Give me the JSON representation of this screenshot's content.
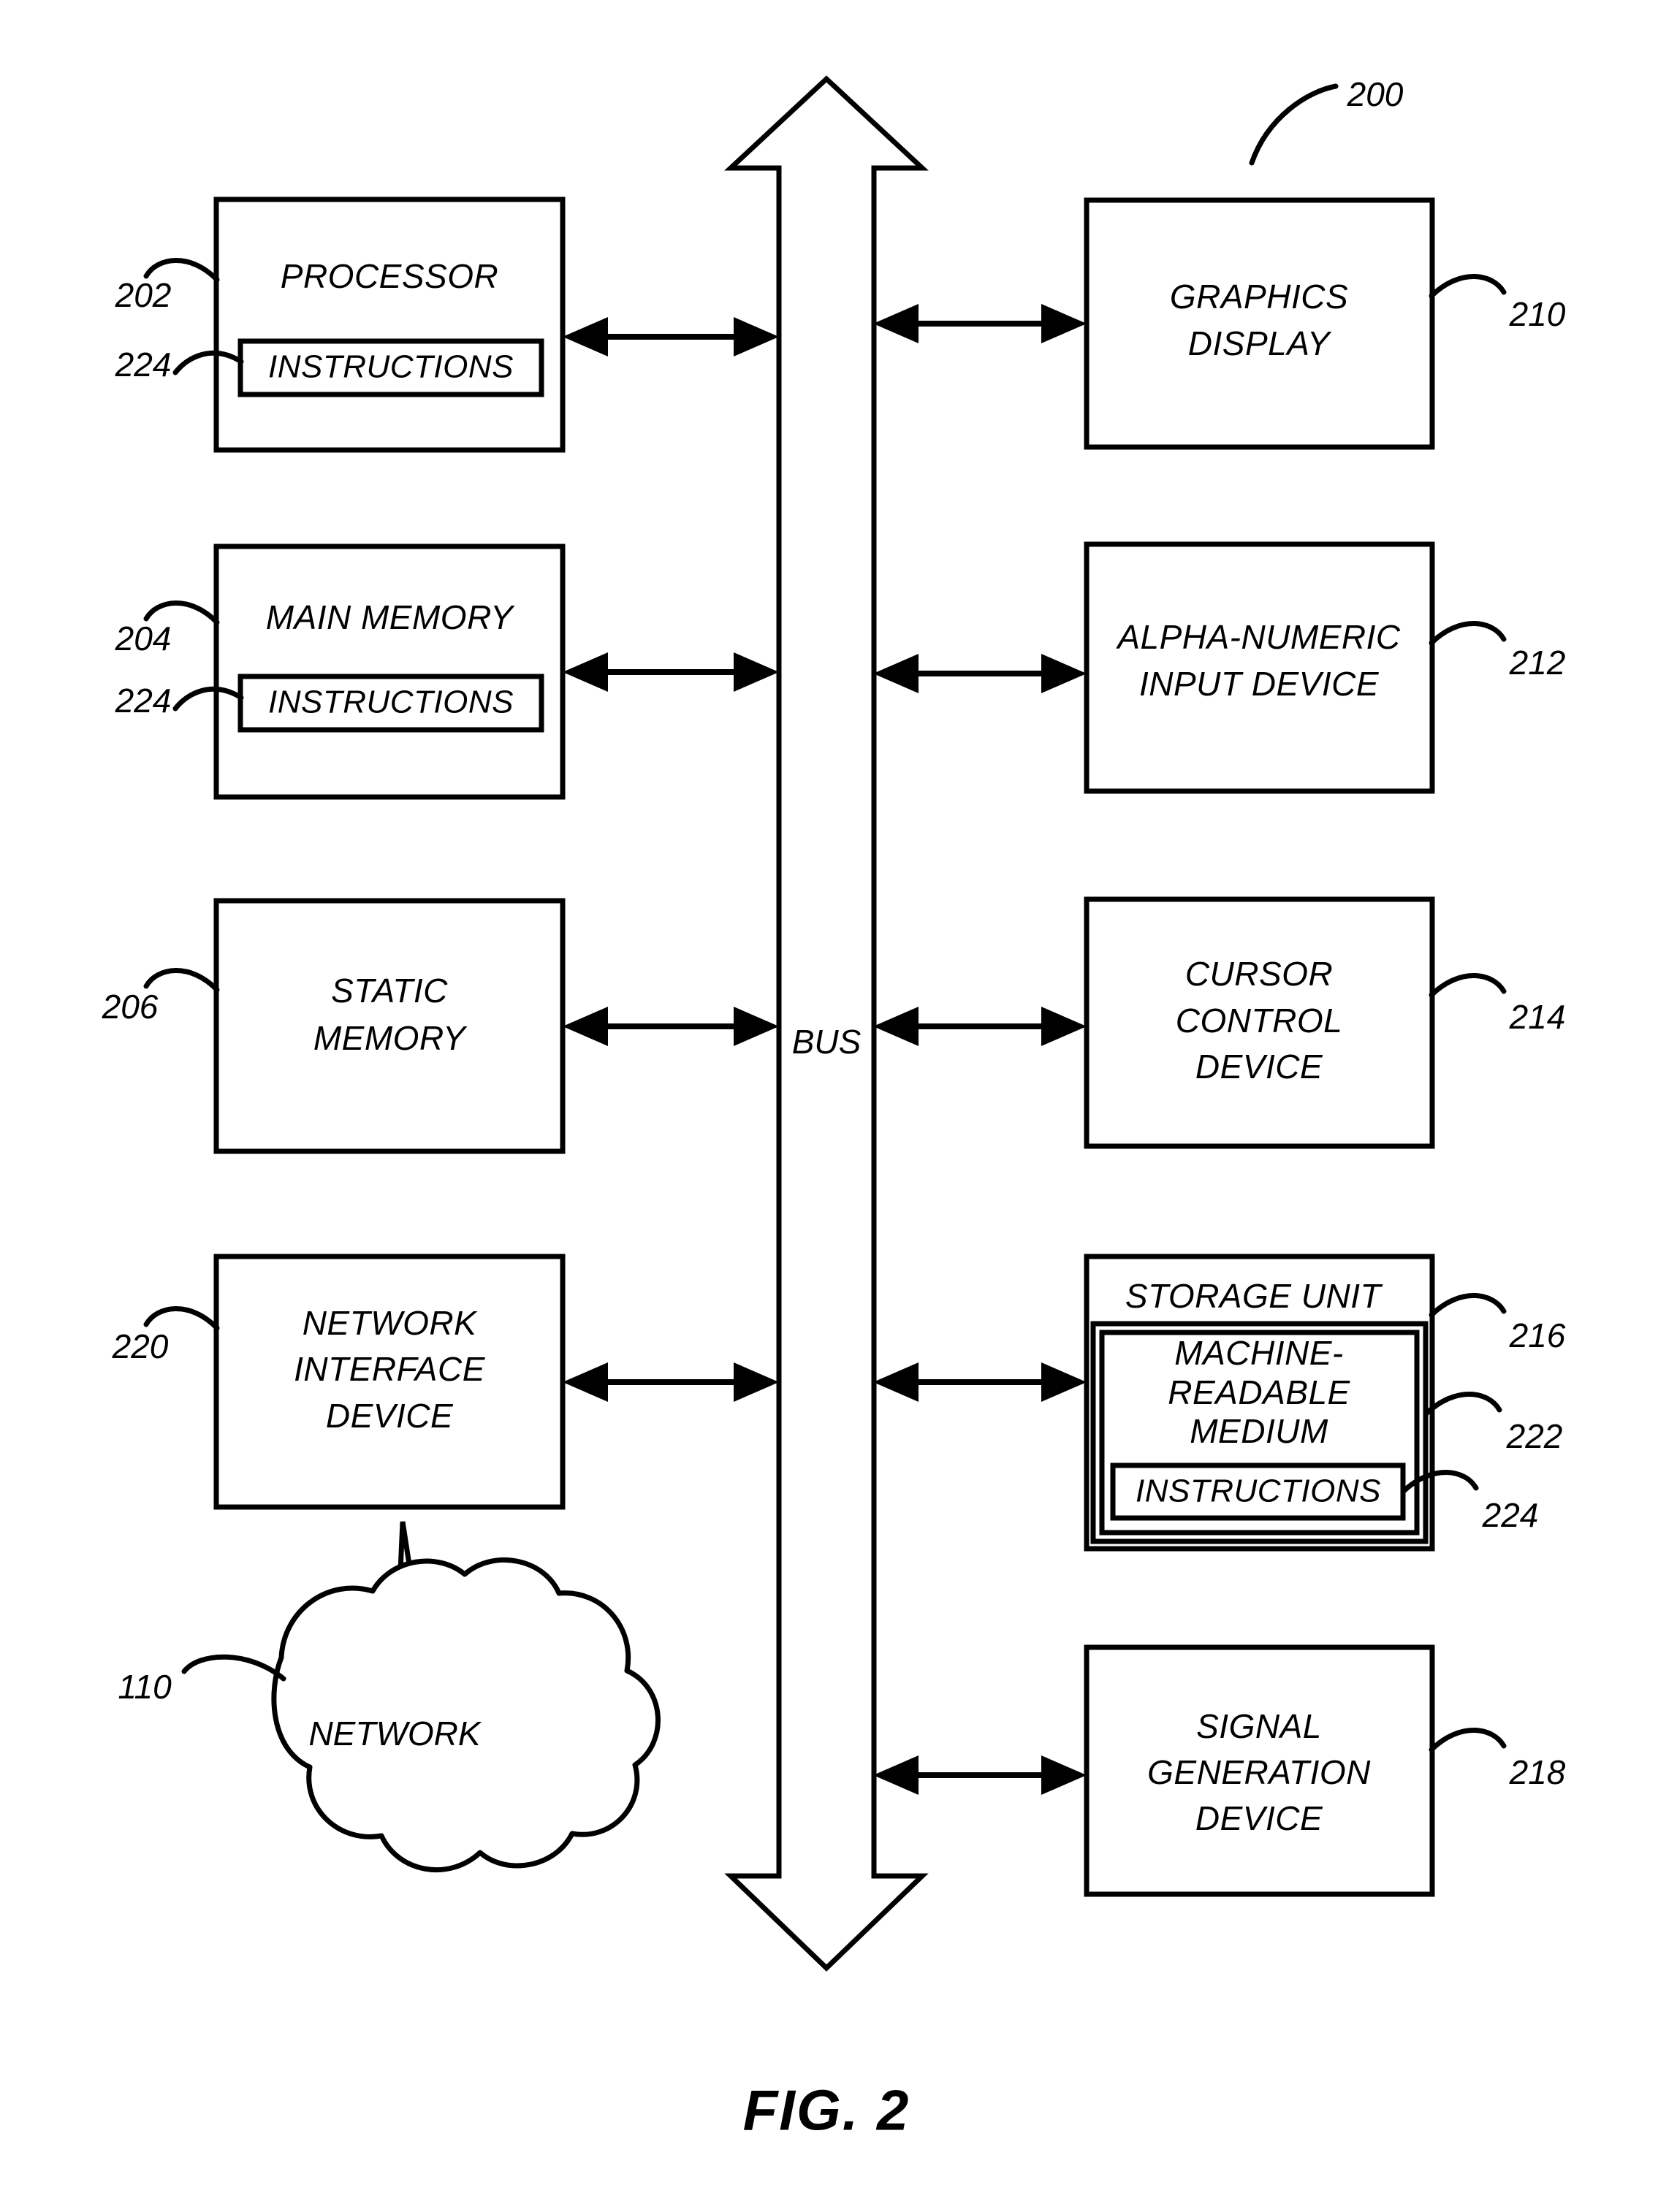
{
  "figure": {
    "caption": "FIG. 2",
    "system_ref": "200"
  },
  "bus": {
    "label": "BUS"
  },
  "left_column": [
    {
      "id": "processor",
      "label": "PROCESSOR",
      "ref": "202",
      "inner": {
        "label": "INSTRUCTIONS",
        "ref": "224"
      }
    },
    {
      "id": "main-memory",
      "label": "MAIN MEMORY",
      "ref": "204",
      "inner": {
        "label": "INSTRUCTIONS",
        "ref": "224"
      }
    },
    {
      "id": "static-memory",
      "label_line1": "STATIC",
      "label_line2": "MEMORY",
      "ref": "206"
    },
    {
      "id": "network-interface-device",
      "label_line1": "NETWORK",
      "label_line2": "INTERFACE",
      "label_line3": "DEVICE",
      "ref": "220"
    }
  ],
  "right_column": [
    {
      "id": "graphics-display",
      "label_line1": "GRAPHICS",
      "label_line2": "DISPLAY",
      "ref": "210"
    },
    {
      "id": "alpha-numeric-input-device",
      "label_line1": "ALPHA-NUMERIC",
      "label_line2": "INPUT DEVICE",
      "ref": "212"
    },
    {
      "id": "cursor-control-device",
      "label_line1": "CURSOR",
      "label_line2": "CONTROL",
      "label_line3": "DEVICE",
      "ref": "214"
    },
    {
      "id": "storage-unit",
      "label": "STORAGE UNIT",
      "ref": "216",
      "medium": {
        "label_line1": "MACHINE-",
        "label_line2": "READABLE",
        "label_line3": "MEDIUM",
        "ref": "222",
        "inner": {
          "label": "INSTRUCTIONS",
          "ref": "224"
        }
      }
    },
    {
      "id": "signal-generation-device",
      "label_line1": "SIGNAL",
      "label_line2": "GENERATION",
      "label_line3": "DEVICE",
      "ref": "218"
    }
  ],
  "network": {
    "label": "NETWORK",
    "ref": "110"
  },
  "colors": {
    "ink": "#000000",
    "paper": "#ffffff"
  }
}
